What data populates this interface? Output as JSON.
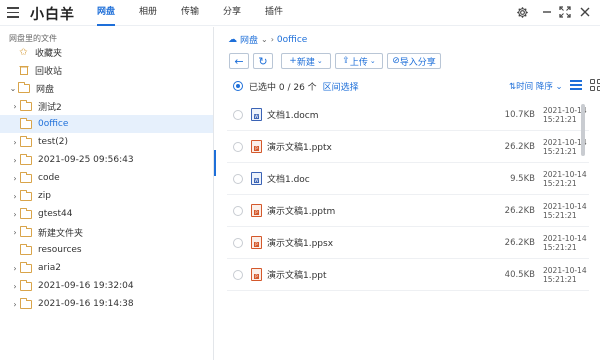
{
  "app": {
    "title": "小白羊"
  },
  "topnav": [
    "网盘",
    "相册",
    "传输",
    "分享",
    "插件"
  ],
  "window_controls": [
    "gear-icon",
    "minimize-icon",
    "maximize-icon",
    "close-icon"
  ],
  "left": {
    "header": "网盘里的文件",
    "items": [
      {
        "label": "收藏夹",
        "icon": "star-folder-icon"
      },
      {
        "label": "回收站",
        "icon": "trash-icon"
      },
      {
        "label": "网盘",
        "icon": "folder-icon"
      },
      {
        "label": "测试2",
        "icon": "folder-icon"
      },
      {
        "label": "0office",
        "icon": "folder-icon"
      },
      {
        "label": "test(2)",
        "icon": "folder-icon"
      },
      {
        "label": "2021-09-25 09:56:43",
        "icon": "folder-icon"
      },
      {
        "label": "code",
        "icon": "folder-icon"
      },
      {
        "label": "zip",
        "icon": "folder-icon"
      },
      {
        "label": "gtest44",
        "icon": "folder-icon"
      },
      {
        "label": "新建文件夹",
        "icon": "folder-icon"
      },
      {
        "label": "resources",
        "icon": "folder-icon"
      },
      {
        "label": "aria2",
        "icon": "folder-icon"
      },
      {
        "label": "2021-09-16 19:32:04",
        "icon": "folder-icon"
      },
      {
        "label": "2021-09-16 19:14:38",
        "icon": "folder-icon"
      }
    ]
  },
  "breadcrumb": {
    "root": "网盘",
    "current": "0office"
  },
  "toolbar": {
    "new_label": "新建",
    "upload_label": "上传",
    "import_share_label": "导入分享"
  },
  "status": {
    "selected": "已选中 0 / 26 个",
    "range_select": "区间选择",
    "sort": "时间 降序"
  },
  "files": [
    {
      "name": "文档1.docm",
      "size": "10.7KB",
      "date": "2021-10-14",
      "time": "15:21:21",
      "type": "doc"
    },
    {
      "name": "演示文稿1.pptx",
      "size": "26.2KB",
      "date": "2021-10-14",
      "time": "15:21:21",
      "type": "ppt"
    },
    {
      "name": "文档1.doc",
      "size": "9.5KB",
      "date": "2021-10-14",
      "time": "15:21:21",
      "type": "doc"
    },
    {
      "name": "演示文稿1.pptm",
      "size": "26.2KB",
      "date": "2021-10-14",
      "time": "15:21:21",
      "type": "ppt"
    },
    {
      "name": "演示文稿1.ppsx",
      "size": "26.2KB",
      "date": "2021-10-14",
      "time": "15:21:21",
      "type": "ppt"
    },
    {
      "name": "演示文稿1.ppt",
      "size": "40.5KB",
      "date": "2021-10-14",
      "time": "15:21:21",
      "type": "ppt"
    }
  ],
  "colors": {
    "accent": "#1e6fd9",
    "folder": "#d9a44a",
    "doc": "#3b63b5",
    "ppt": "#d4582b"
  }
}
